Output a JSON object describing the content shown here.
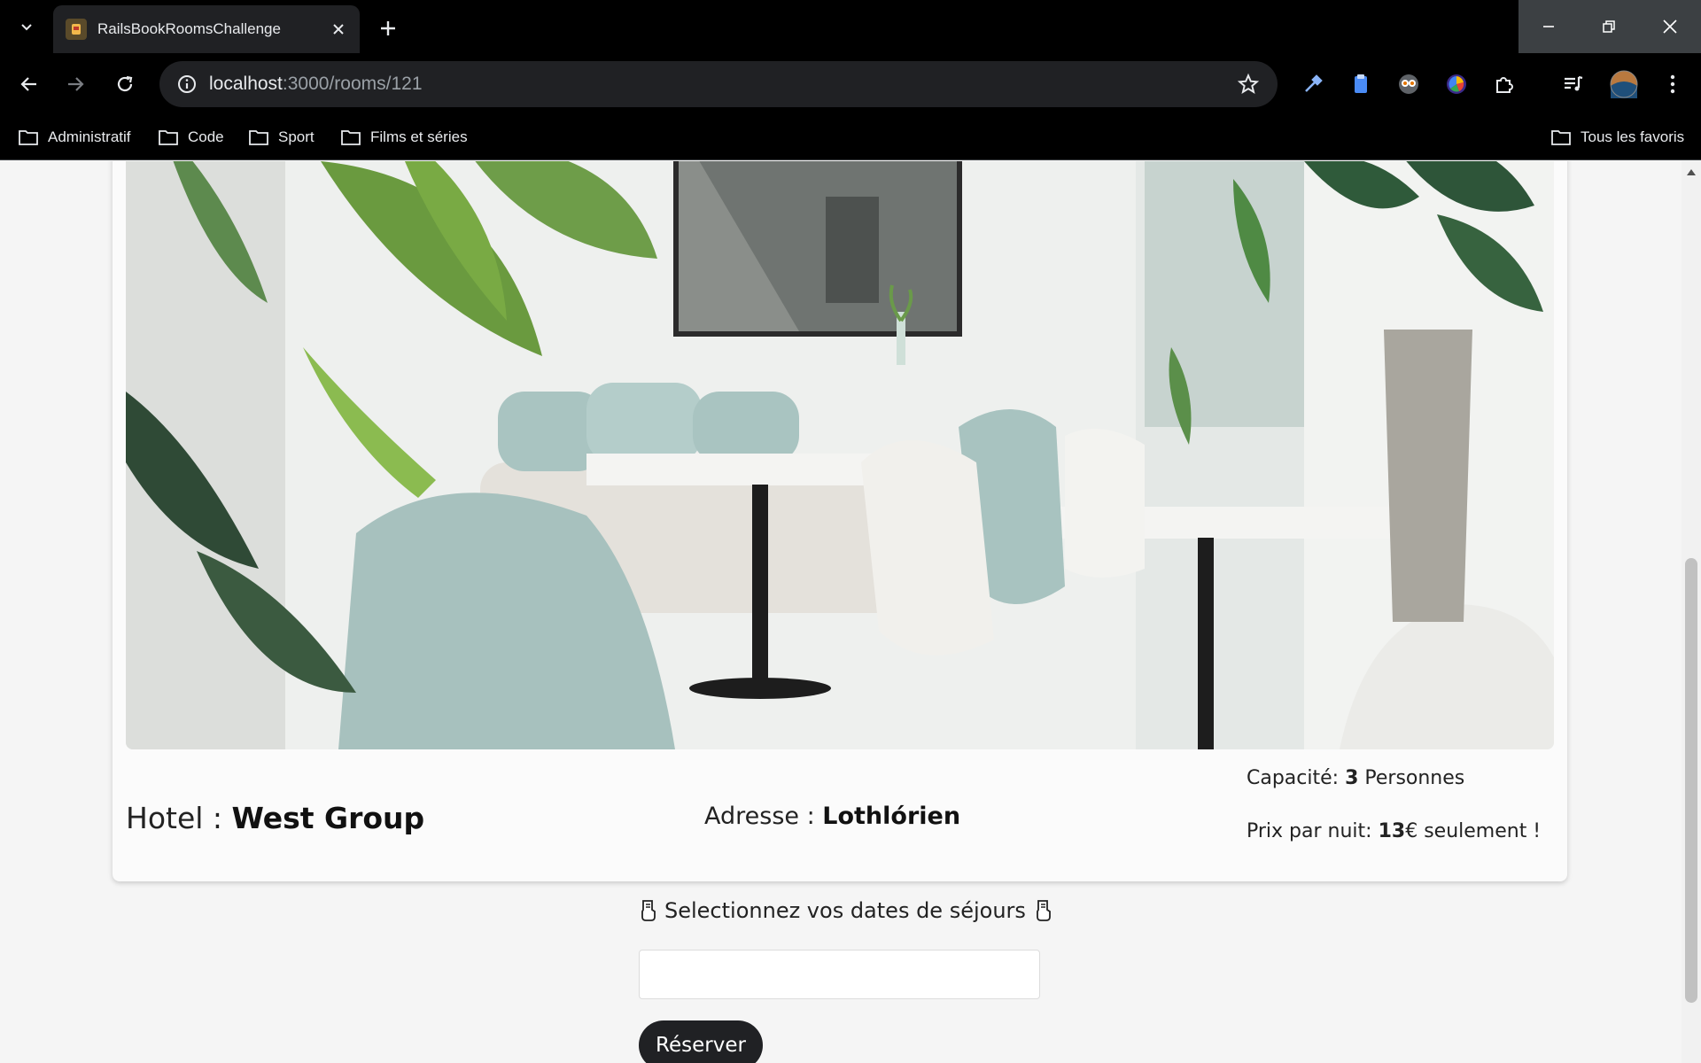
{
  "browser": {
    "tab_title": "RailsBookRoomsChallenge",
    "url_host": "localhost",
    "url_rest": ":3000/rooms/121",
    "bookmarks": [
      "Administratif",
      "Code",
      "Sport",
      "Films et séries"
    ],
    "all_bookmarks": "Tous les favoris"
  },
  "room": {
    "hotel_label": "Hotel : ",
    "hotel_name": "West Group",
    "address_label": "Adresse : ",
    "address_value": "Lothlórien",
    "capacity_label": "Capacité: ",
    "capacity_value": "3",
    "capacity_unit": " Personnes",
    "price_label": "Prix par nuit: ",
    "price_value": "13",
    "price_suffix": "€ seulement !"
  },
  "booking": {
    "select_text": "Selectionnez vos dates de séjours",
    "date_input_value": "",
    "reserve_label": "Réserver"
  }
}
